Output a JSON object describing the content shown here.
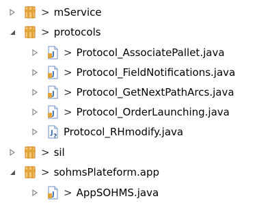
{
  "tree": {
    "items": [
      {
        "label": "mService",
        "dirty": true,
        "kind": "package",
        "expanded": false,
        "level": 0
      },
      {
        "label": "protocols",
        "dirty": true,
        "kind": "package",
        "expanded": true,
        "level": 0
      },
      {
        "label": "Protocol_AssociatePallet.java",
        "dirty": true,
        "kind": "java",
        "expanded": false,
        "level": 1
      },
      {
        "label": "Protocol_FieldNotifications.java",
        "dirty": true,
        "kind": "java",
        "expanded": false,
        "level": 1
      },
      {
        "label": "Protocol_GetNextPathArcs.java",
        "dirty": true,
        "kind": "java",
        "expanded": false,
        "level": 1
      },
      {
        "label": "Protocol_OrderLaunching.java",
        "dirty": true,
        "kind": "java",
        "expanded": false,
        "level": 1
      },
      {
        "label": "Protocol_RHmodify.java",
        "dirty": false,
        "kind": "java-unknown",
        "expanded": false,
        "level": 1
      },
      {
        "label": "sil",
        "dirty": true,
        "kind": "package",
        "expanded": false,
        "level": 0
      },
      {
        "label": "sohmsPlateform.app",
        "dirty": true,
        "kind": "package",
        "expanded": true,
        "level": 0
      },
      {
        "label": "AppSOHMS.java",
        "dirty": true,
        "kind": "java",
        "expanded": false,
        "level": 1
      }
    ],
    "dirty_marker": ">"
  },
  "colors": {
    "package_orange": "#E2A33B",
    "java_blue": "#3A6FB0",
    "twisty_gray": "#8A8A8A"
  }
}
